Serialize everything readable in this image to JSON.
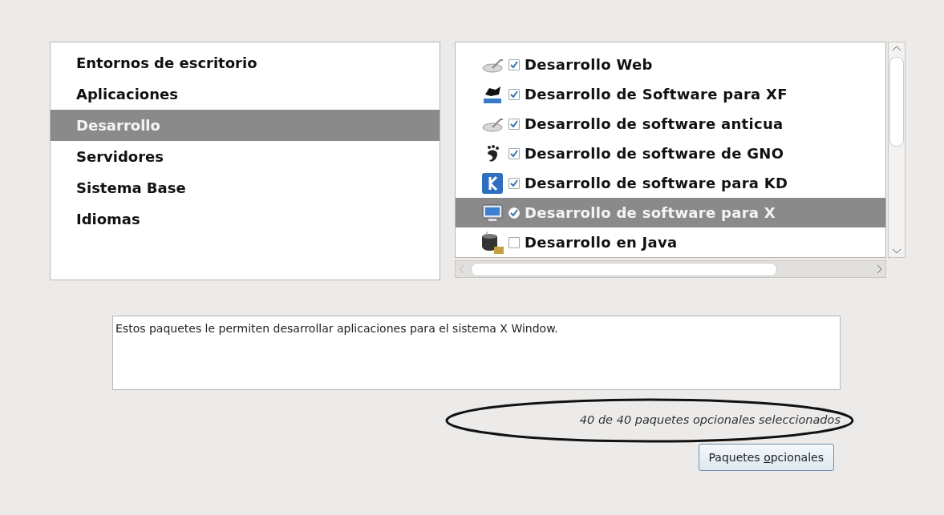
{
  "categories": [
    {
      "label": "Entornos de escritorio",
      "selected": false
    },
    {
      "label": "Aplicaciones",
      "selected": false
    },
    {
      "label": "Desarrollo",
      "selected": true
    },
    {
      "label": "Servidores",
      "selected": false
    },
    {
      "label": "Sistema Base",
      "selected": false
    },
    {
      "label": "Idiomas",
      "selected": false
    }
  ],
  "groups": [
    {
      "kind": "web",
      "label": "Desarrollo Web",
      "checked": true,
      "selected": false
    },
    {
      "kind": "xfce",
      "label": "Desarrollo de Software para XF",
      "checked": true,
      "selected": false
    },
    {
      "kind": "legacy",
      "label": "Desarrollo de software anticua",
      "checked": true,
      "selected": false
    },
    {
      "kind": "gnome",
      "label": "Desarrollo de software de GNO",
      "checked": true,
      "selected": false
    },
    {
      "kind": "kde",
      "label": "Desarrollo de software para KD",
      "checked": true,
      "selected": false
    },
    {
      "kind": "monitor",
      "label": "Desarrollo de software para X",
      "checked": true,
      "selected": true
    },
    {
      "kind": "java",
      "label": "Desarrollo en Java",
      "checked": false,
      "selected": false
    }
  ],
  "description": "Estos paquetes le permiten desarrollar aplicaciones para el sistema X Window.",
  "status": "40 de 40 paquetes opcionales seleccionados",
  "button": {
    "label_parts": [
      "Paquetes ",
      "o",
      "pcionales"
    ]
  }
}
